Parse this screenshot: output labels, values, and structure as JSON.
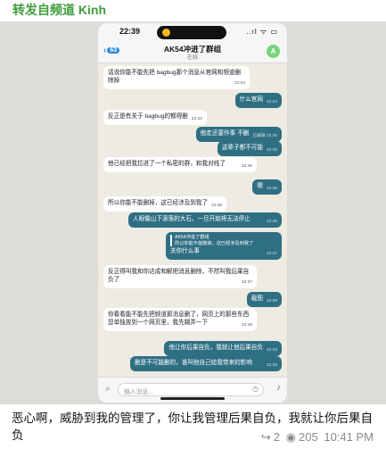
{
  "forwarded_from": "转发自频道 Kinh",
  "phone": {
    "status_time": "22:39",
    "status_icons": "..ıl ᯤ ▭",
    "back_count": "63",
    "chat_title": "AK54冲进了群组",
    "chat_status": "在线",
    "avatar_letter": "A",
    "input_placeholder": "输入消息..."
  },
  "messages": [
    {
      "dir": "in",
      "text": "话说你能不能先把 bagbug那个消息从官网和频道删除掉",
      "time": "22:34"
    },
    {
      "dir": "out",
      "text": "什么官网",
      "time": "22:34"
    },
    {
      "dir": "in",
      "text": "反正是有关于 bagbug的都得删",
      "time": "22:34"
    },
    {
      "dir": "out",
      "text": "他走还要作事 不删",
      "time": "已编辑 22:35"
    },
    {
      "dir": "out",
      "text": "这辈子都不可能",
      "time": "22:35"
    },
    {
      "dir": "in",
      "text": "他已经把我拉进了一个私密的群，和我对线了",
      "time": "22:36"
    },
    {
      "dir": "out",
      "text": "嗯",
      "time": "22:36"
    },
    {
      "dir": "in",
      "text": "所以你能不能删掉，这已经涉及到我了",
      "time": "22:36"
    },
    {
      "dir": "out",
      "text": "人眼像山下滚落的大石，一旦开始将无法停止",
      "time": "22:36"
    },
    {
      "dir": "out",
      "quote_name": "AK54冲进了群组",
      "quote_text": "所以你能不能删掉，这已经涉及到我了",
      "text": "关你什么事",
      "time": "22:37"
    },
    {
      "dir": "in",
      "text": "反正得叫我和你达成和解把消息删除，不然叫我后果自负了",
      "time": "22:37"
    },
    {
      "dir": "out",
      "text": "截图",
      "time": "22:38"
    },
    {
      "dir": "in",
      "text": "你看看能不能先把频道那消息删了，网页上的那些东西您单独放到一个网页里，我先糊弄一下",
      "time": "22:39"
    },
    {
      "dir": "out",
      "text": "他让你后果自负，我就让他后果自负",
      "time": "22:39"
    },
    {
      "dir": "out",
      "text": "删是不可能删的，谁叫他自己给我带来的影响",
      "time": "22:39"
    }
  ],
  "caption": "恶心啊，威胁到我的管理了，你让我管理后果自负，我就让你后果自负",
  "footer": {
    "forwards": "2",
    "views": "205",
    "time": "10:41 PM"
  }
}
